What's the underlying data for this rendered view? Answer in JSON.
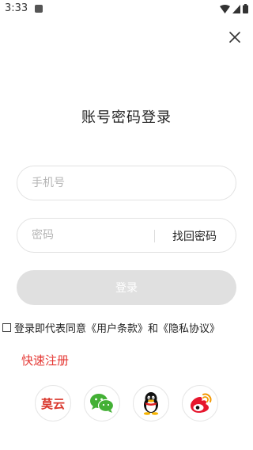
{
  "status_bar": {
    "time": "3:33"
  },
  "page": {
    "title": "账号密码登录"
  },
  "phone_field": {
    "placeholder": "手机号",
    "value": ""
  },
  "password_field": {
    "placeholder": "密码",
    "value": ""
  },
  "forgot_password": {
    "label": "找回密码"
  },
  "login_button": {
    "label": "登录"
  },
  "agreement": {
    "text": "登录即代表同意《用户条款》和《隐私协议》",
    "checked": false
  },
  "register_link": {
    "label": "快速注册"
  },
  "social_logins": [
    {
      "icon": "mojiyun-logo-icon",
      "logo_text": "莫云"
    },
    {
      "icon": "wechat-icon"
    },
    {
      "icon": "qq-icon"
    },
    {
      "icon": "weibo-icon"
    }
  ],
  "colors": {
    "accent_red": "#e53935",
    "button_disabled": "#e0e0e0",
    "border": "#e2e2e2"
  }
}
